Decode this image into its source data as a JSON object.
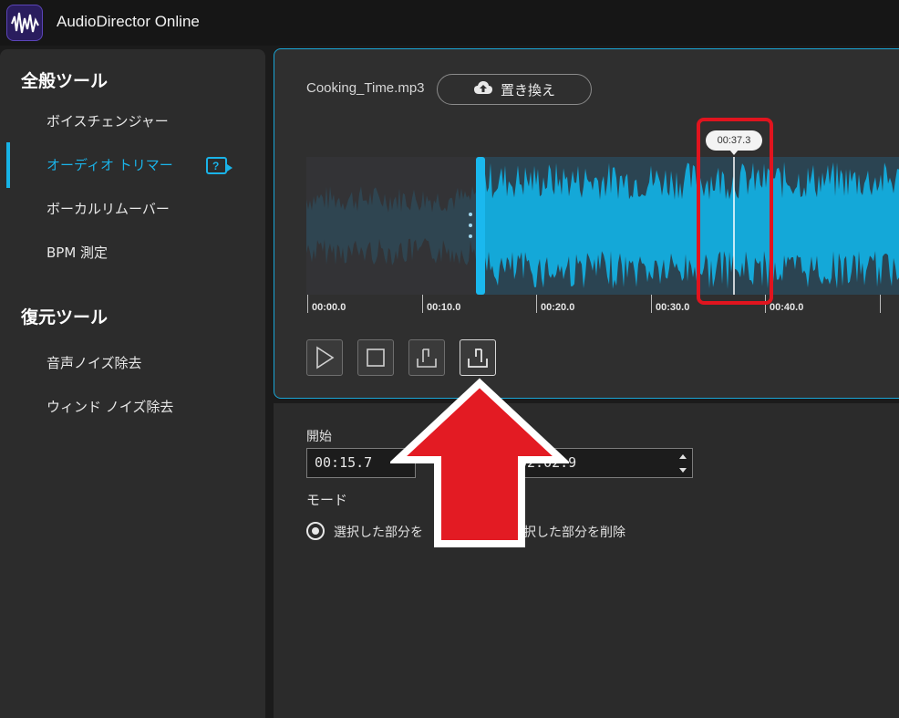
{
  "app": {
    "title": "AudioDirector Online",
    "logo_icon": "waveform-logo-icon"
  },
  "sidebar": {
    "group1": "全般ツール",
    "items1": [
      {
        "label": "ボイスチェンジャー"
      },
      {
        "label": "オーディオ トリマー",
        "active": true
      },
      {
        "label": "ボーカルリムーバー"
      },
      {
        "label": "BPM 測定"
      }
    ],
    "help_icon": "help-video-icon",
    "group2": "復元ツール",
    "items2": [
      {
        "label": "音声ノイズ除去"
      },
      {
        "label": "ウィンド ノイズ除去"
      }
    ]
  },
  "editor": {
    "filename": "Cooking_Time.mp3",
    "replace_label": "置き換え",
    "replace_icon": "cloud-upload-icon",
    "playhead_time": "00:37.3",
    "ruler_ticks": [
      "00:00.0",
      "00:10.0",
      "00:20.0",
      "00:30.0",
      "00:40.0"
    ],
    "controls": [
      {
        "name": "play-button",
        "icon": "play-icon"
      },
      {
        "name": "stop-button",
        "icon": "stop-icon"
      },
      {
        "name": "set-start-button",
        "icon": "mark-start-icon"
      },
      {
        "name": "set-end-button",
        "icon": "mark-end-icon"
      }
    ]
  },
  "settings": {
    "start_label": "開始",
    "start_value": "00:15.7",
    "end_value": "02:02.9",
    "mode_label": "モード",
    "mode_keep": "選択した部分を",
    "mode_delete": "択した部分を削除"
  },
  "colors": {
    "accent": "#17b3e6",
    "annotation_red": "#e0141e"
  }
}
